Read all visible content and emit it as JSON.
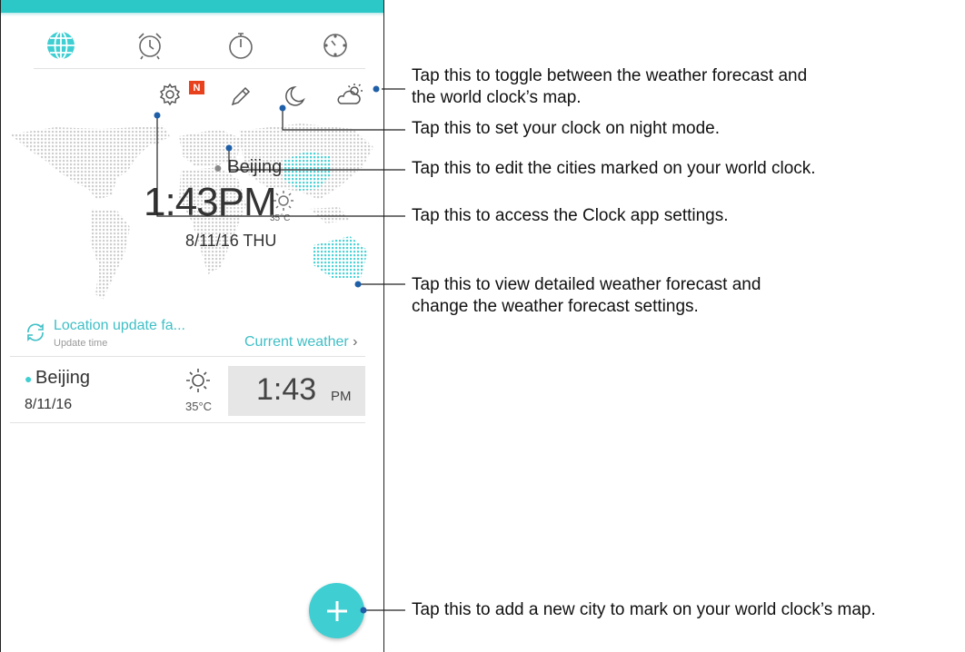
{
  "tabs": {
    "icons": [
      "globe-icon",
      "alarm-clock-icon",
      "stopwatch-icon",
      "timer-icon"
    ],
    "active_color": "#3fcfd2"
  },
  "header_icons": {
    "settings": "gear-icon",
    "badge": "N",
    "edit": "pencil-icon",
    "night_mode": "moon-icon",
    "weather_toggle": "cloud-sun-icon"
  },
  "map": {
    "city": "Beijing",
    "time": "1:43PM",
    "temp": "35°C",
    "date": "8/11/16 THU"
  },
  "location": {
    "status": "Location update fa...",
    "sub": "Update time",
    "current_weather": "Current weather"
  },
  "city_row": {
    "city": "Beijing",
    "date": "8/11/16",
    "temp": "35°C",
    "time": "1:43",
    "ampm": "PM"
  },
  "fab": {
    "icon": "plus-icon",
    "color": "#3fcfd2"
  },
  "callouts": {
    "weather_toggle": "Tap this to toggle between the weather forecast and\nthe world clock’s map.",
    "night_mode": "Tap this to set your clock on night mode.",
    "edit_cities": "Tap this to edit the cities marked on your world clock.",
    "settings": "Tap this to access the Clock app settings.",
    "weather_detail": "Tap this to view detailed weather forecast and\nchange the weather forecast settings.",
    "add_city": "Tap this to add a new city to mark on your world clock’s map."
  }
}
